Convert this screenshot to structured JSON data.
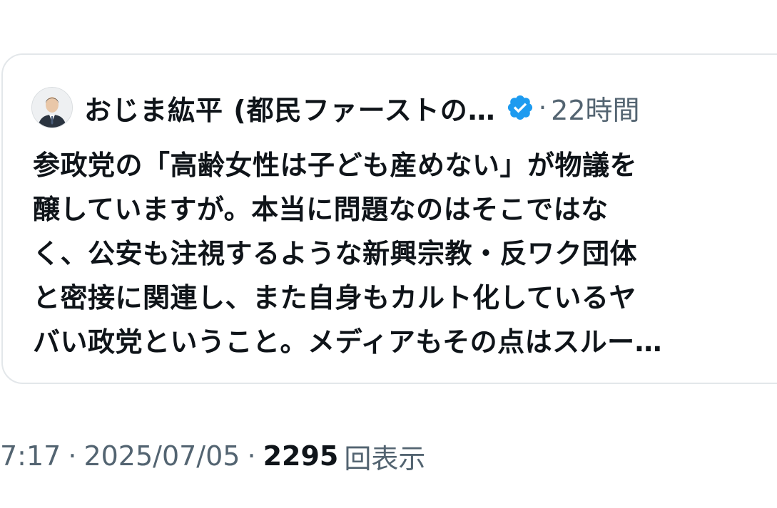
{
  "quoted_post": {
    "author_name": "おじま紘平 (都民ファーストの…",
    "separator": "·",
    "time_ago": "22時間",
    "text_lines": [
      "参政党の「高齢女性は子ども産めない」が物議を",
      "醸していますが。本当に問題なのはそこではな",
      "く、公安も注視するような新興宗教・反ワク団体",
      "と密接に関連し、また自身もカルト化しているヤ",
      "バい政党ということ。メディアもその点はスルー…"
    ],
    "verified_color": "#1d9bf0"
  },
  "post_meta": {
    "time": "7:17",
    "separator": "·",
    "date": "2025/07/05",
    "views_count": "2295",
    "views_label": "回表示"
  }
}
